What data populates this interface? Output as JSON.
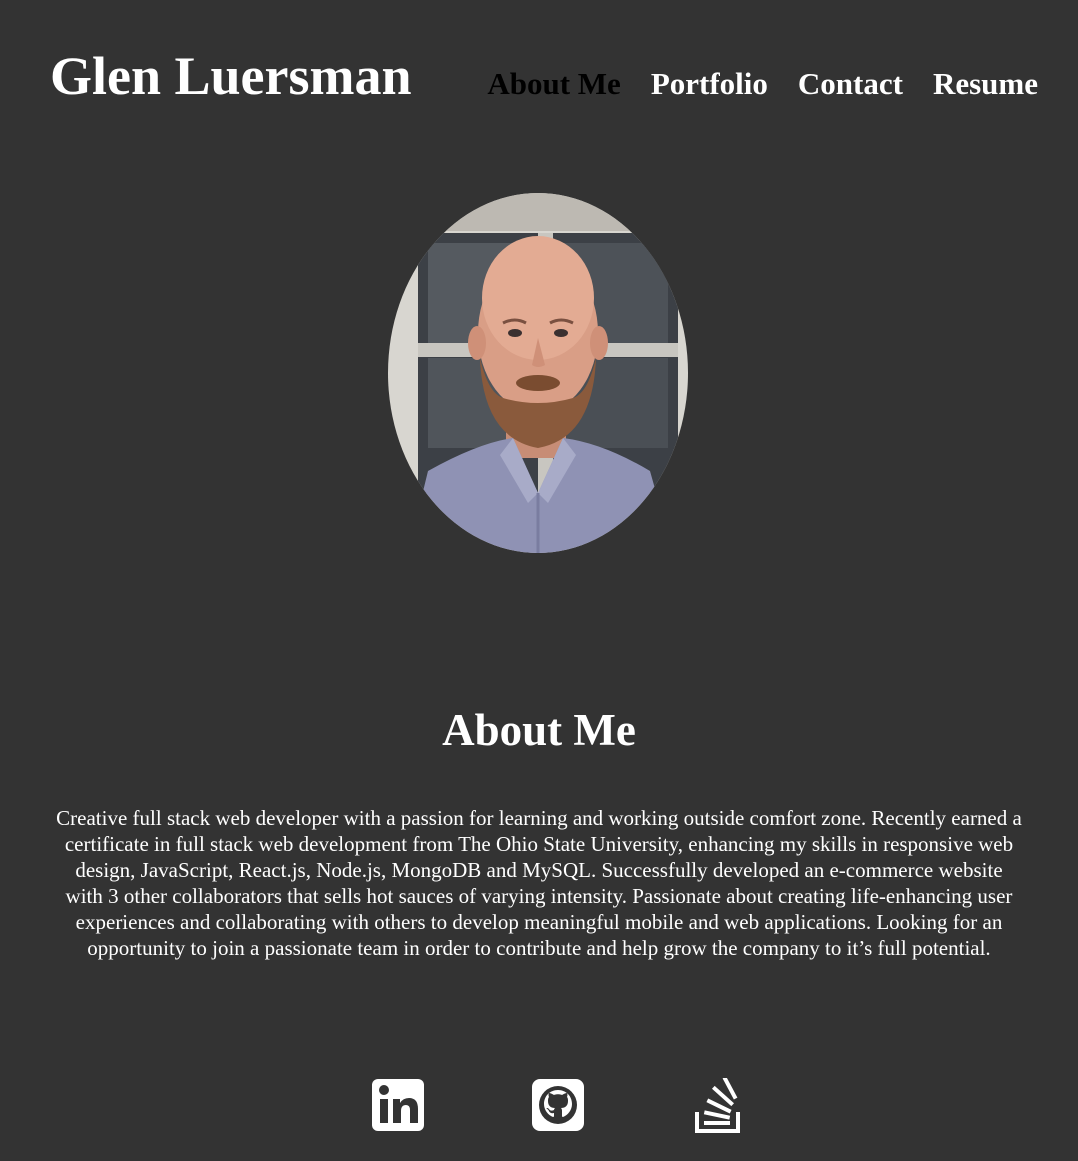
{
  "header": {
    "title": "Glen Luersman",
    "nav": [
      {
        "label": "About Me",
        "active": true
      },
      {
        "label": "Portfolio",
        "active": false
      },
      {
        "label": "Contact",
        "active": false
      },
      {
        "label": "Resume",
        "active": false
      }
    ]
  },
  "main": {
    "section_title": "About Me",
    "about_text": "Creative full stack web developer with a passion for learning and working outside comfort zone. Recently earned a certificate in full stack web development from The Ohio State University, enhancing my skills in responsive web design, JavaScript, React.js, Node.js, MongoDB and MySQL. Successfully developed an e-commerce website with 3 other collaborators that sells hot sauces of varying intensity. Passionate about creating life-enhancing user experiences and collaborating with others to develop meaningful mobile and web applications. Looking for an opportunity to join a passionate team in order to contribute and help grow the company to it’s full potential."
  },
  "social": [
    {
      "icon": "linkedin-icon"
    },
    {
      "icon": "github-icon"
    },
    {
      "icon": "stackoverflow-icon"
    }
  ],
  "colors": {
    "background": "#333333",
    "text": "#ffffff",
    "active_nav": "#000000"
  }
}
